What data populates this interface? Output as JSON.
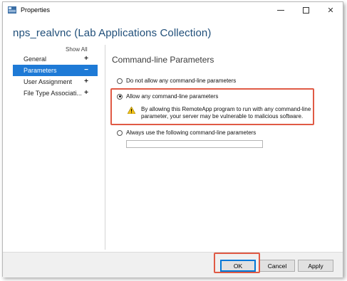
{
  "window": {
    "title": "Properties",
    "app_icon": "server-manager-icon"
  },
  "header": {
    "title": "nps_realvnc (Lab Applications Collection)"
  },
  "nav": {
    "show_all_label": "Show All",
    "items": [
      {
        "label": "General",
        "sign": "+",
        "selected": false
      },
      {
        "label": "Parameters",
        "sign": "−",
        "selected": true
      },
      {
        "label": "User Assignment",
        "sign": "+",
        "selected": false
      },
      {
        "label": "File Type Associati...",
        "sign": "+",
        "selected": false
      }
    ]
  },
  "panel": {
    "title": "Command-line Parameters",
    "options": [
      {
        "label": "Do not allow any command-line parameters",
        "checked": false
      },
      {
        "label": "Allow any command-line parameters",
        "checked": true
      },
      {
        "label": "Always use the following command-line parameters",
        "checked": false
      }
    ],
    "warning": {
      "icon": "warning-icon",
      "text": "By allowing this RemoteApp program to run with any command-line parameter, your server may be vulnerable to malicious software."
    },
    "parameters_value": ""
  },
  "footer": {
    "ok_label": "OK",
    "cancel_label": "Cancel",
    "apply_label": "Apply"
  },
  "colors": {
    "accent": "#1e7ad6",
    "header_text": "#1f4e79",
    "highlight": "#e05a45"
  }
}
